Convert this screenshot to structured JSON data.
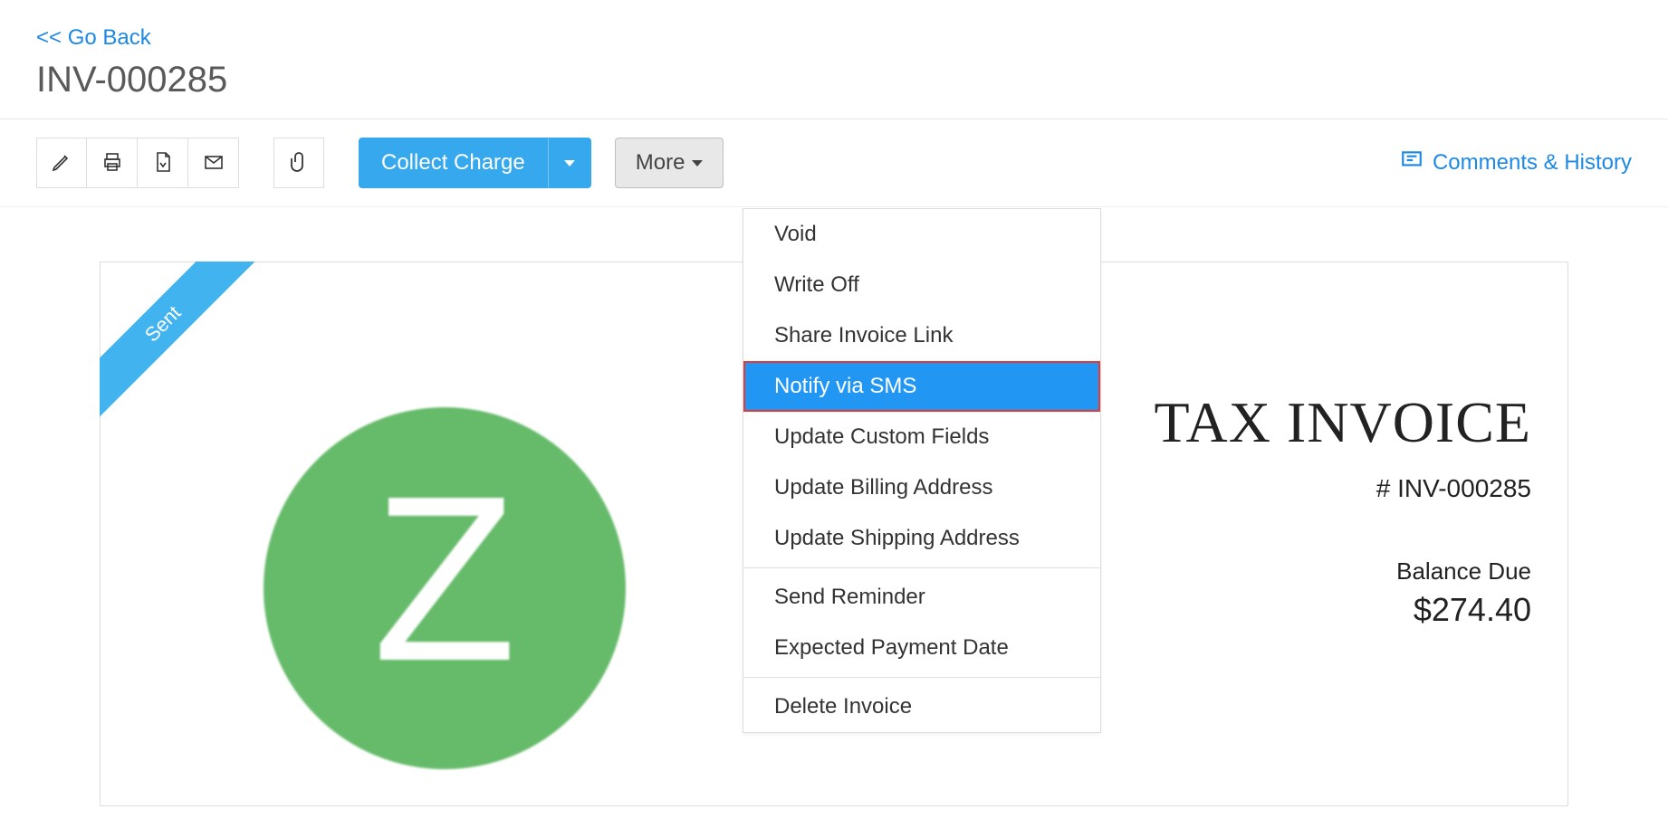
{
  "header": {
    "go_back": "<< Go Back",
    "invoice_number": "INV-000285"
  },
  "toolbar": {
    "collect_charge": "Collect Charge",
    "more": "More",
    "comments": "Comments & History"
  },
  "dropdown": {
    "items": [
      "Void",
      "Write Off",
      "Share Invoice Link",
      "Notify via SMS",
      "Update Custom Fields",
      "Update Billing Address",
      "Update Shipping Address"
    ],
    "group2": [
      "Send Reminder",
      "Expected Payment Date"
    ],
    "group3": [
      "Delete Invoice"
    ],
    "highlighted_index": 3
  },
  "invoice": {
    "status": "Sent",
    "title": "TAX INVOICE",
    "number": "# INV-000285",
    "balance_label": "Balance Due",
    "balance_amount": "$274.40",
    "logo_letter": "Z"
  }
}
